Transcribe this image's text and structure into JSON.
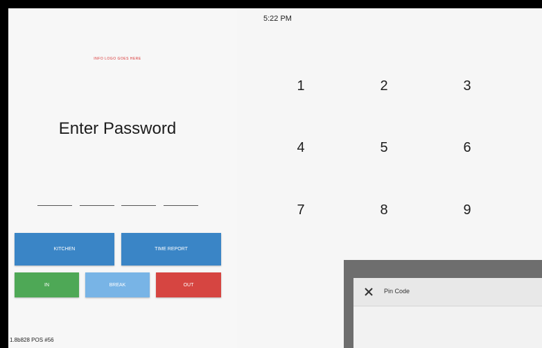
{
  "status_bar": {
    "time": "5:22 PM"
  },
  "login": {
    "logo_text": "INFO LOGO GOES HERE",
    "title": "Enter Password",
    "pin_slots": 4,
    "buttons": {
      "kitchen": "KITCHEN",
      "time_report": "TIME REPORT",
      "in": "IN",
      "break": "BREAK",
      "out": "OUT"
    },
    "version": "1.8b828  POS #56"
  },
  "keypad": {
    "keys": [
      "1",
      "2",
      "3",
      "4",
      "5",
      "6",
      "7",
      "8",
      "9"
    ]
  },
  "dialog": {
    "title": "Pin Code",
    "close_icon": "close-icon"
  },
  "colors": {
    "blue": "#3a85c6",
    "light_blue": "#78b4e6",
    "green": "#4ea856",
    "red": "#d64541",
    "background": "#f6f6f6",
    "logo": "#d83030"
  }
}
